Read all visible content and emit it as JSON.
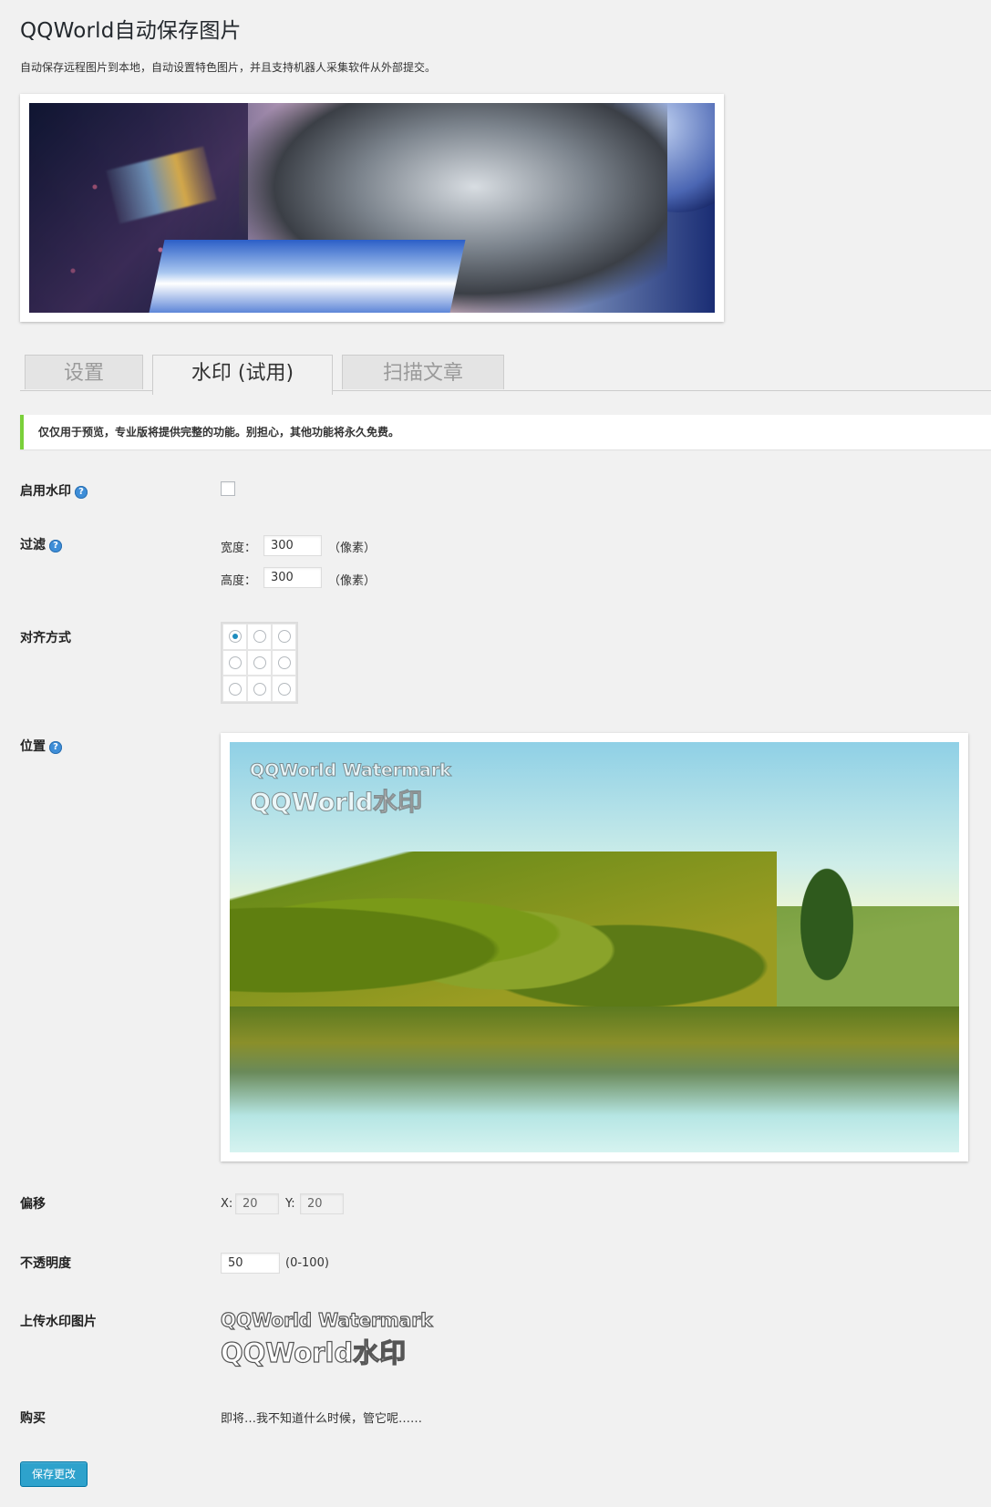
{
  "header": {
    "title": "QQWorld自动保存图片",
    "description": "自动保存远程图片到本地，自动设置特色图片，并且支持机器人采集软件从外部提交。"
  },
  "tabs": [
    {
      "label": "设置",
      "active": false
    },
    {
      "label": "水印 (试用)",
      "active": true
    },
    {
      "label": "扫描文章",
      "active": false
    }
  ],
  "notice": "仅仅用于预览，专业版将提供完整的功能。别担心，其他功能将永久免费。",
  "fields": {
    "enable": {
      "label": "启用水印",
      "checked": false
    },
    "filter": {
      "label": "过滤",
      "width_label": "宽度：",
      "width_value": "300",
      "height_label": "高度：",
      "height_value": "300",
      "unit": "（像素）"
    },
    "align": {
      "label": "对齐方式",
      "selected_index": 0
    },
    "position": {
      "label": "位置",
      "watermark_line1": "QQWorld Watermark",
      "watermark_line2": "QQWorld水印"
    },
    "offset": {
      "label": "偏移",
      "x_label": "X:",
      "x_value": "20",
      "y_label": "Y:",
      "y_value": "20"
    },
    "opacity": {
      "label": "不透明度",
      "value": "50",
      "range": "(0-100)"
    },
    "upload": {
      "label": "上传水印图片",
      "line1": "QQWorld Watermark",
      "line2": "QQWorld水印"
    },
    "buy": {
      "label": "购买",
      "text": "即将…我不知道什么时候，管它呢……"
    }
  },
  "save_button": "保存更改",
  "colors": {
    "accent": "#2ea2cc",
    "notice_border": "#7ad03a",
    "help_icon": "#3e8ed8"
  }
}
